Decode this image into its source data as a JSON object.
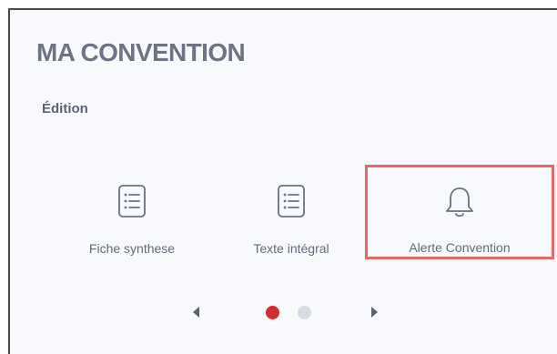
{
  "header": {
    "title": "MA CONVENTION"
  },
  "section": {
    "label": "Édition"
  },
  "tiles": [
    {
      "label": "Fiche synthese",
      "icon": "list-document-icon"
    },
    {
      "label": "Texte intégral",
      "icon": "list-document-icon"
    },
    {
      "label": "Alerte Convention",
      "icon": "bell-icon",
      "highlighted": true
    }
  ],
  "carousel": {
    "page_count": 2,
    "active_page": 1
  },
  "colors": {
    "title": "#6d7486",
    "text": "#626a7d",
    "highlight_border": "#e46a66",
    "active_dot": "#d42e2e",
    "inactive_dot": "#d9dce4",
    "background": "#f8f9fc"
  }
}
